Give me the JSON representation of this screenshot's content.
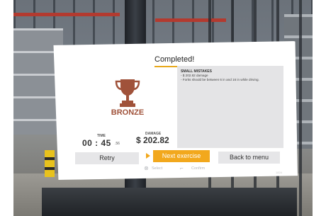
{
  "dialog": {
    "title": "Completed!",
    "medal": "BRONZE",
    "medal_icon": "trophy-icon",
    "medal_color": "#a0523a",
    "accent_color": "#f2a81d",
    "time": {
      "label": "TIME",
      "value": "00 : 45",
      "fraction": ".56"
    },
    "damage": {
      "label": "DAMAGE",
      "value": "$ 202.82"
    },
    "mistakes": {
      "title": "SMALL MISTAKES",
      "items": [
        "- $ 202.82 damage",
        "- Forks should be between 6 in and 16 in while driving."
      ]
    },
    "buttons": {
      "retry": "Retry",
      "next": "Next exercise",
      "menu": "Back to menu"
    },
    "hints": {
      "select": "Select",
      "select_icon": "controller-button-icon",
      "confirm": "Confirm",
      "confirm_icon": "trigger-icon"
    },
    "version": "1824"
  }
}
